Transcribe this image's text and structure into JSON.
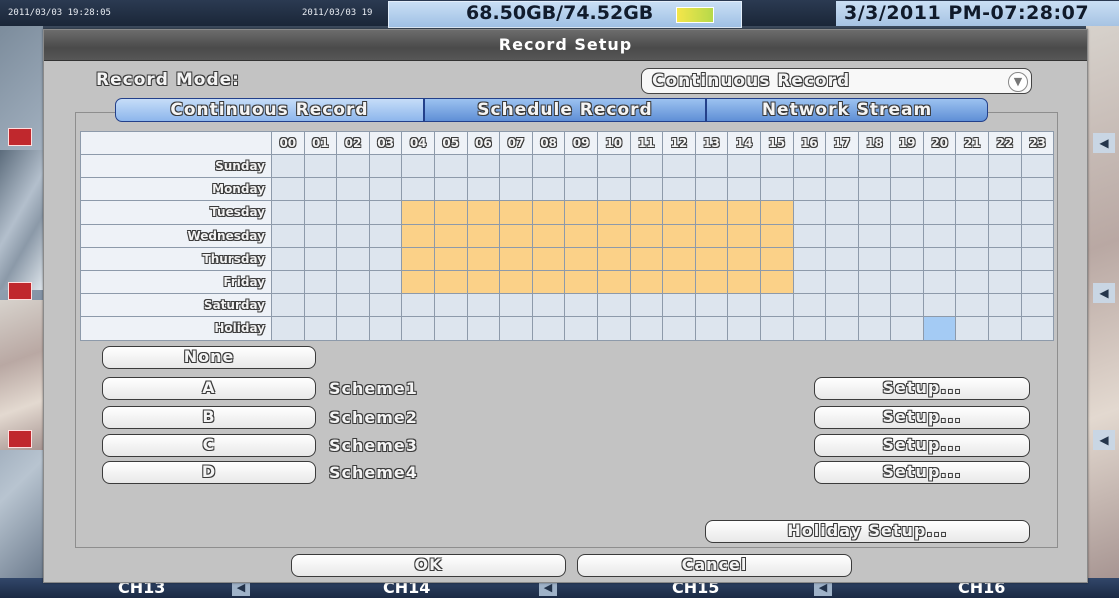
{
  "background": {
    "top_left_timestamp": "2011/03/03 19:28:05",
    "top_mid_timestamp": "2011/03/03 19",
    "hdd_usage": "68.50GB/74.52GB",
    "clock": "3/3/2011 PM-07:28:07",
    "channels": [
      "CH13",
      "CH14",
      "CH15",
      "CH16"
    ]
  },
  "dialog": {
    "title": "Record Setup",
    "record_mode_label": "Record Mode:",
    "record_mode_value": "Continuous Record",
    "tabs": [
      "Continuous Record",
      "Schedule Record",
      "Network Stream"
    ],
    "active_tab": 0,
    "schedule": {
      "hours": [
        "00",
        "01",
        "02",
        "03",
        "04",
        "05",
        "06",
        "07",
        "08",
        "09",
        "10",
        "11",
        "12",
        "13",
        "14",
        "15",
        "16",
        "17",
        "18",
        "19",
        "20",
        "21",
        "22",
        "23"
      ],
      "days": [
        {
          "label": "Sunday",
          "slots": "........................"
        },
        {
          "label": "Monday",
          "slots": "........................"
        },
        {
          "label": "Tuesday",
          "slots": "....cccccccccccc........"
        },
        {
          "label": "Wednesday",
          "slots": "....cccccccccccc........"
        },
        {
          "label": "Thursday",
          "slots": "....cccccccccccc........"
        },
        {
          "label": "Friday",
          "slots": "....cccccccccccc........"
        },
        {
          "label": "Saturday",
          "slots": "........................"
        },
        {
          "label": "Holiday",
          "slots": "....................h..."
        }
      ]
    },
    "none_button": "None",
    "schemes": [
      {
        "button": "A",
        "name": "Scheme1",
        "setup": "Setup..."
      },
      {
        "button": "B",
        "name": "Scheme2",
        "setup": "Setup..."
      },
      {
        "button": "C",
        "name": "Scheme3",
        "setup": "Setup..."
      },
      {
        "button": "D",
        "name": "Scheme4",
        "setup": "Setup..."
      }
    ],
    "holiday_setup": "Holiday Setup...",
    "ok": "OK",
    "cancel": "Cancel"
  },
  "colors": {
    "continuous_slot": "#fbd188",
    "holiday_slot": "#a4cbf4",
    "empty_slot": "#dde5ee",
    "tab_blue": "#7aa7e6"
  }
}
